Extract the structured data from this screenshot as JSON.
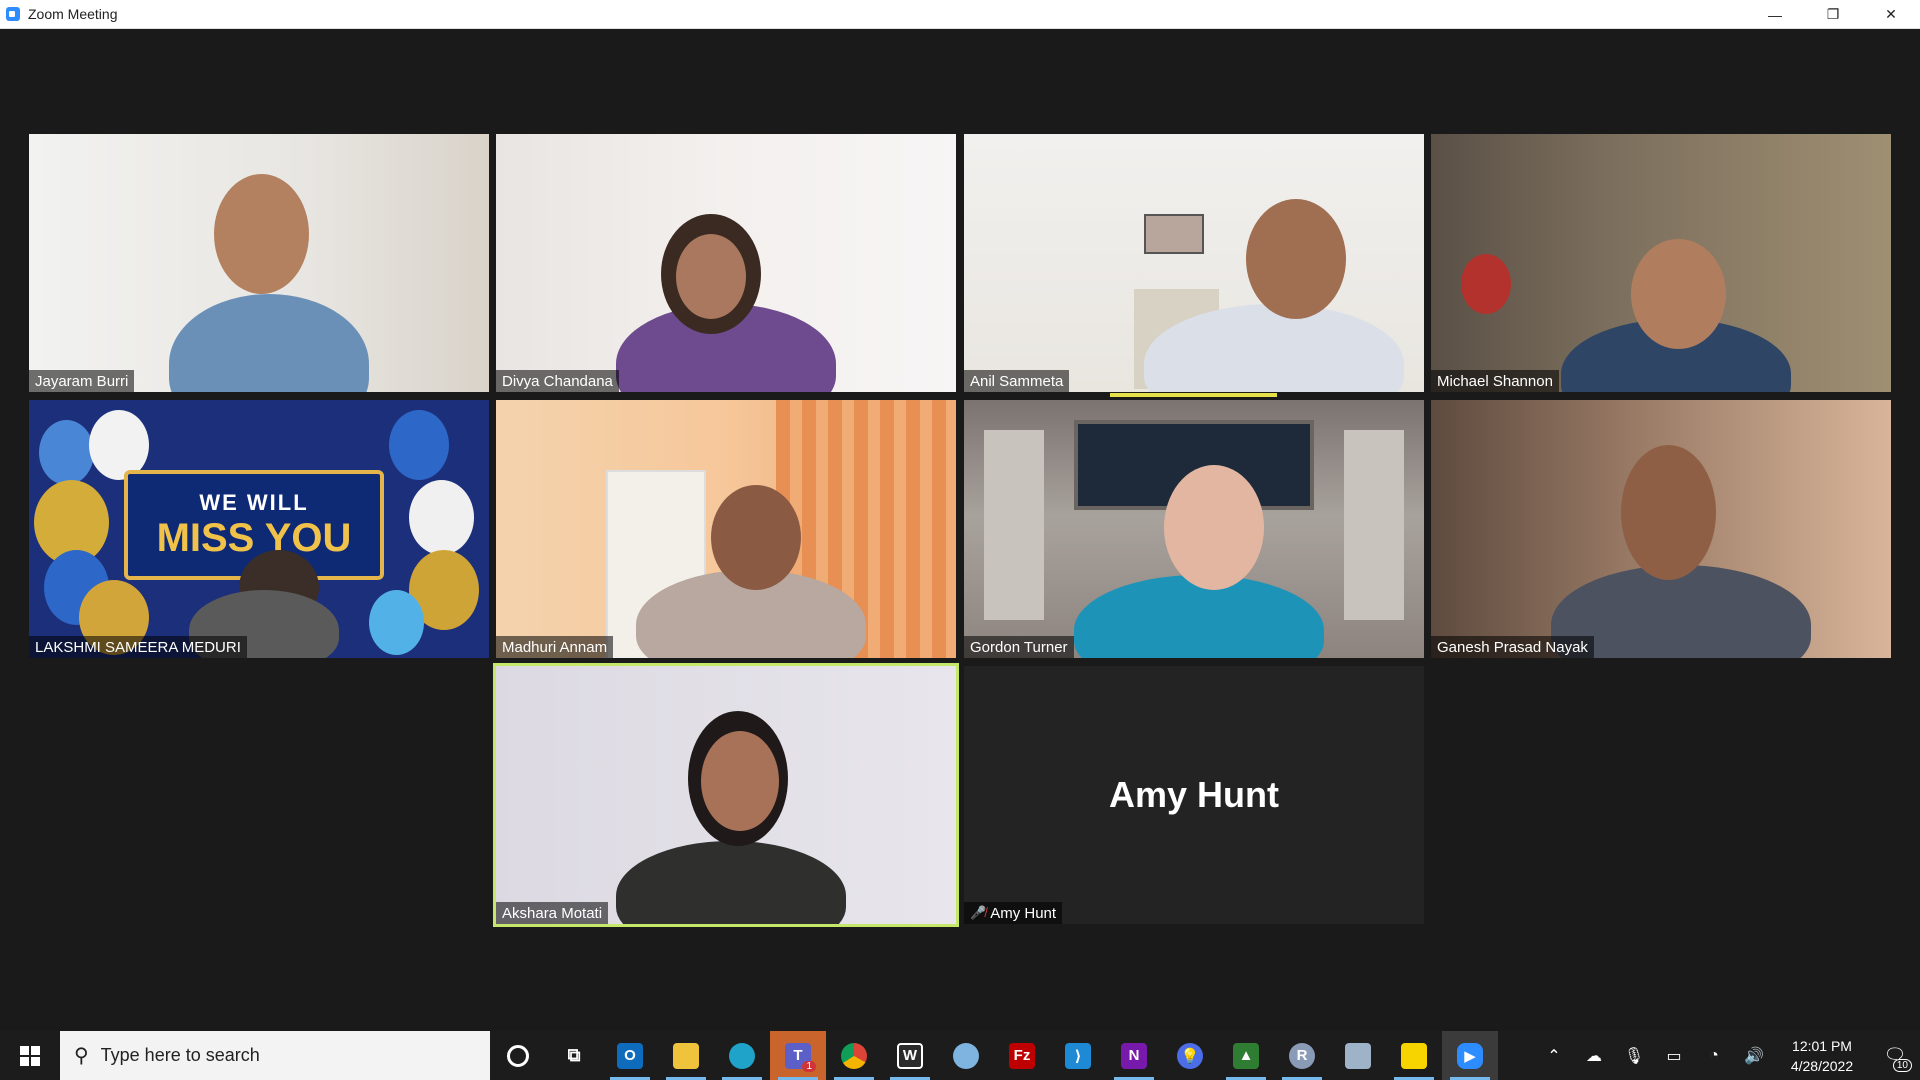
{
  "window": {
    "title": "Zoom Meeting",
    "minimize": "—",
    "maximize": "❐",
    "close": "✕"
  },
  "participants": [
    {
      "name": "Jayaram Burri",
      "muted": false
    },
    {
      "name": "Divya Chandana",
      "muted": false
    },
    {
      "name": "Anil Sammeta",
      "muted": false
    },
    {
      "name": "Michael Shannon",
      "muted": false
    },
    {
      "name": "LAKSHMI SAMEERA MEDURI",
      "muted": false
    },
    {
      "name": "Madhuri Annam",
      "muted": false
    },
    {
      "name": "Gordon Turner",
      "muted": false
    },
    {
      "name": "Ganesh Prasad Nayak",
      "muted": false
    },
    {
      "name": "Akshara Motati",
      "muted": false,
      "active_speaker": true
    },
    {
      "name": "Amy Hunt",
      "muted": true,
      "video_off": true
    }
  ],
  "banner": {
    "line1": "WE WILL",
    "line2": "MISS YOU"
  },
  "taskbar": {
    "search_placeholder": "Type here to search",
    "apps": [
      {
        "icon": "cortana-icon"
      },
      {
        "icon": "task-view-icon"
      },
      {
        "icon": "outlook-icon",
        "label": "O"
      },
      {
        "icon": "file-explorer-icon"
      },
      {
        "icon": "edge-icon"
      },
      {
        "icon": "teams-icon",
        "label": "T",
        "badge": "1"
      },
      {
        "icon": "chrome-icon"
      },
      {
        "icon": "app-icon",
        "label": "W"
      },
      {
        "icon": "paint-icon"
      },
      {
        "icon": "filezilla-icon",
        "label": "Fz"
      },
      {
        "icon": "vscode-icon"
      },
      {
        "icon": "onenote-icon",
        "label": "N"
      },
      {
        "icon": "tips-icon"
      },
      {
        "icon": "app2-icon"
      },
      {
        "icon": "r-icon",
        "label": "R"
      },
      {
        "icon": "file-icon"
      },
      {
        "icon": "sticky-notes-icon"
      },
      {
        "icon": "zoom-icon"
      }
    ],
    "time": "12:01 PM",
    "date": "4/28/2022",
    "notification_count": "10"
  },
  "colors": {
    "active_speaker_border": "#c6e86a",
    "speaking_bar": "#e6e04a",
    "taskbar_bg": "#1c1c1c",
    "meeting_bg": "#1a1a1a"
  }
}
